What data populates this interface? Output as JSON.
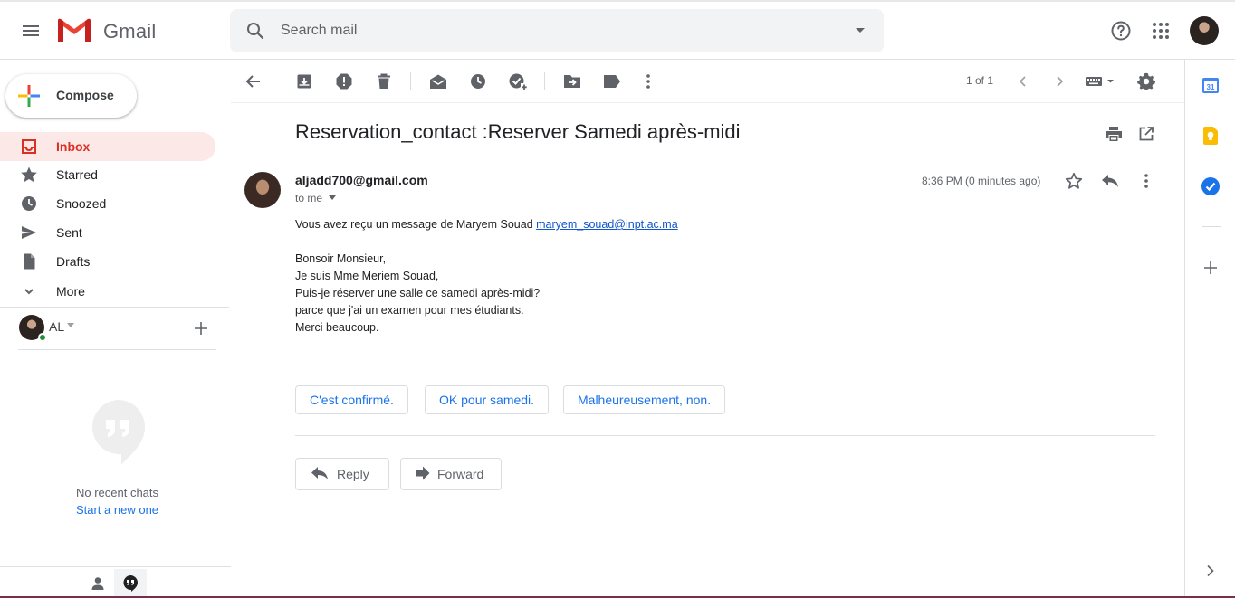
{
  "app": {
    "logo_text": "Gmail",
    "search_placeholder": "Search mail"
  },
  "nav": {
    "compose_label": "Compose",
    "items": [
      {
        "label": "Inbox",
        "icon": "inbox-icon",
        "active": true
      },
      {
        "label": "Starred",
        "icon": "star-icon"
      },
      {
        "label": "Snoozed",
        "icon": "clock-icon"
      },
      {
        "label": "Sent",
        "icon": "send-icon"
      },
      {
        "label": "Drafts",
        "icon": "draft-icon"
      },
      {
        "label": "More",
        "icon": "chevron-down-icon"
      }
    ]
  },
  "hangouts": {
    "user_name": "AL",
    "no_chats": "No recent chats",
    "start_new": "Start a new one"
  },
  "toolbar": {
    "pager": "1 of 1"
  },
  "email": {
    "subject": "Reservation_contact :Reserver Samedi après-midi",
    "sender": "aljadd700@gmail.com",
    "to": "to me",
    "timestamp": "8:36 PM (0 minutes ago)",
    "body_intro": "Vous avez reçu un message de Maryem Souad",
    "body_link": "maryem_souad@inpt.ac.ma",
    "body_lines": [
      "Bonsoir Monsieur,",
      "Je suis Mme Meriem Souad,",
      "Puis-je réserver une salle ce samedi après-midi?",
      "parce que j'ai un examen pour mes étudiants.",
      "Merci beaucoup."
    ],
    "smart_replies": [
      "C'est confirmé.",
      "OK pour samedi.",
      "Malheureusement, non."
    ],
    "reply_label": "Reply",
    "forward_label": "Forward"
  },
  "colors": {
    "accent_red": "#d93025",
    "link_blue": "#1a73e8",
    "inbox_bg": "#fce8e6"
  }
}
